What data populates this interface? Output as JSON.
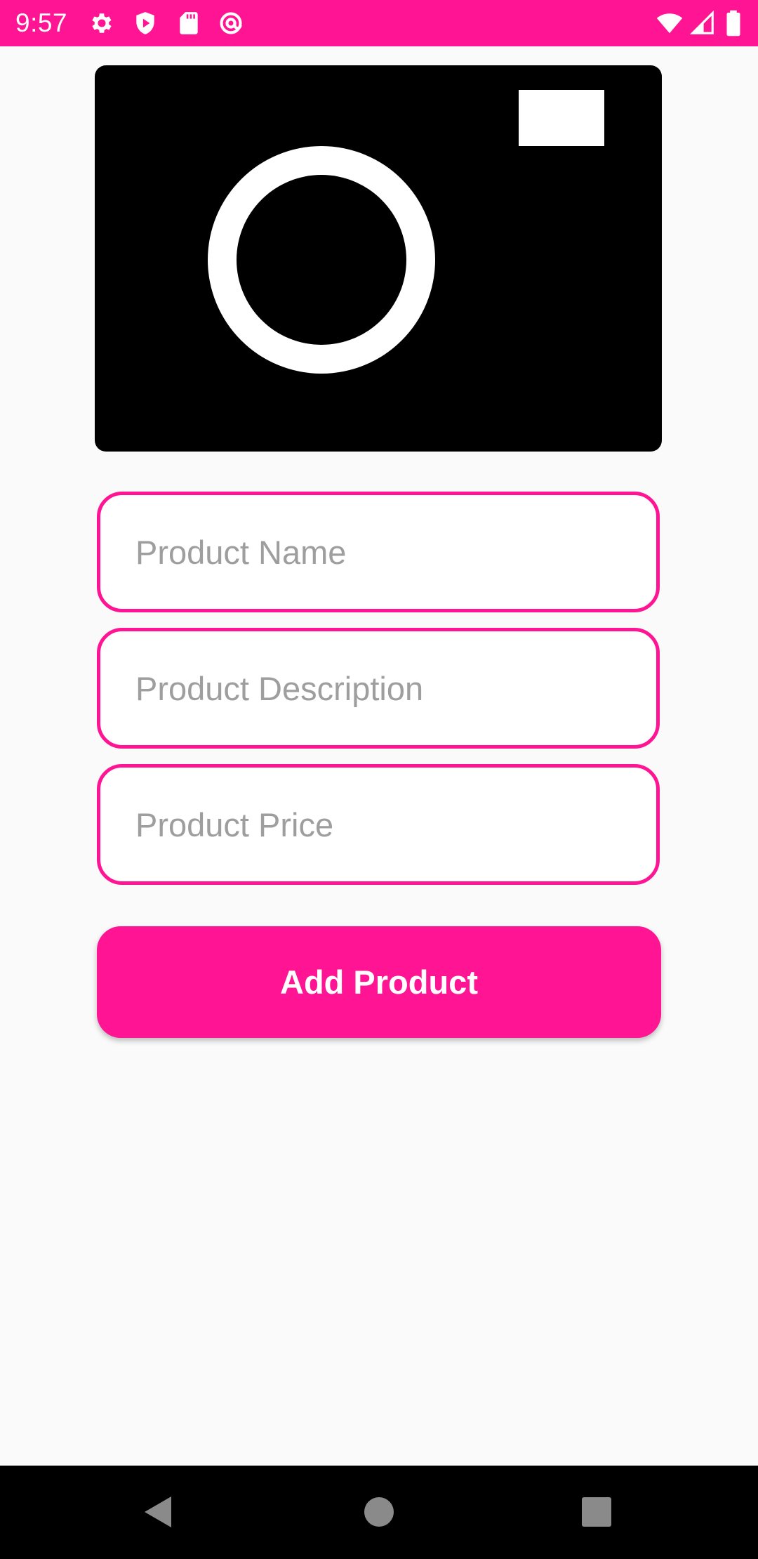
{
  "status_bar": {
    "time": "9:57",
    "background_color": "#FF1493",
    "left_icons": [
      "gear-icon",
      "shield-play-icon",
      "sd-card-icon",
      "at-sign-icon"
    ],
    "right_icons": [
      "wifi-icon",
      "cellular-signal-icon",
      "battery-icon"
    ]
  },
  "product_image": {
    "icon": "camera-icon"
  },
  "form": {
    "name_placeholder": "Product Name",
    "description_placeholder": "Product Description",
    "price_placeholder": "Product Price",
    "accent_color": "#FF1493"
  },
  "add_button": {
    "label": "Add Product"
  },
  "nav_bar": {
    "buttons": [
      "back-icon",
      "home-icon",
      "recents-icon"
    ]
  }
}
